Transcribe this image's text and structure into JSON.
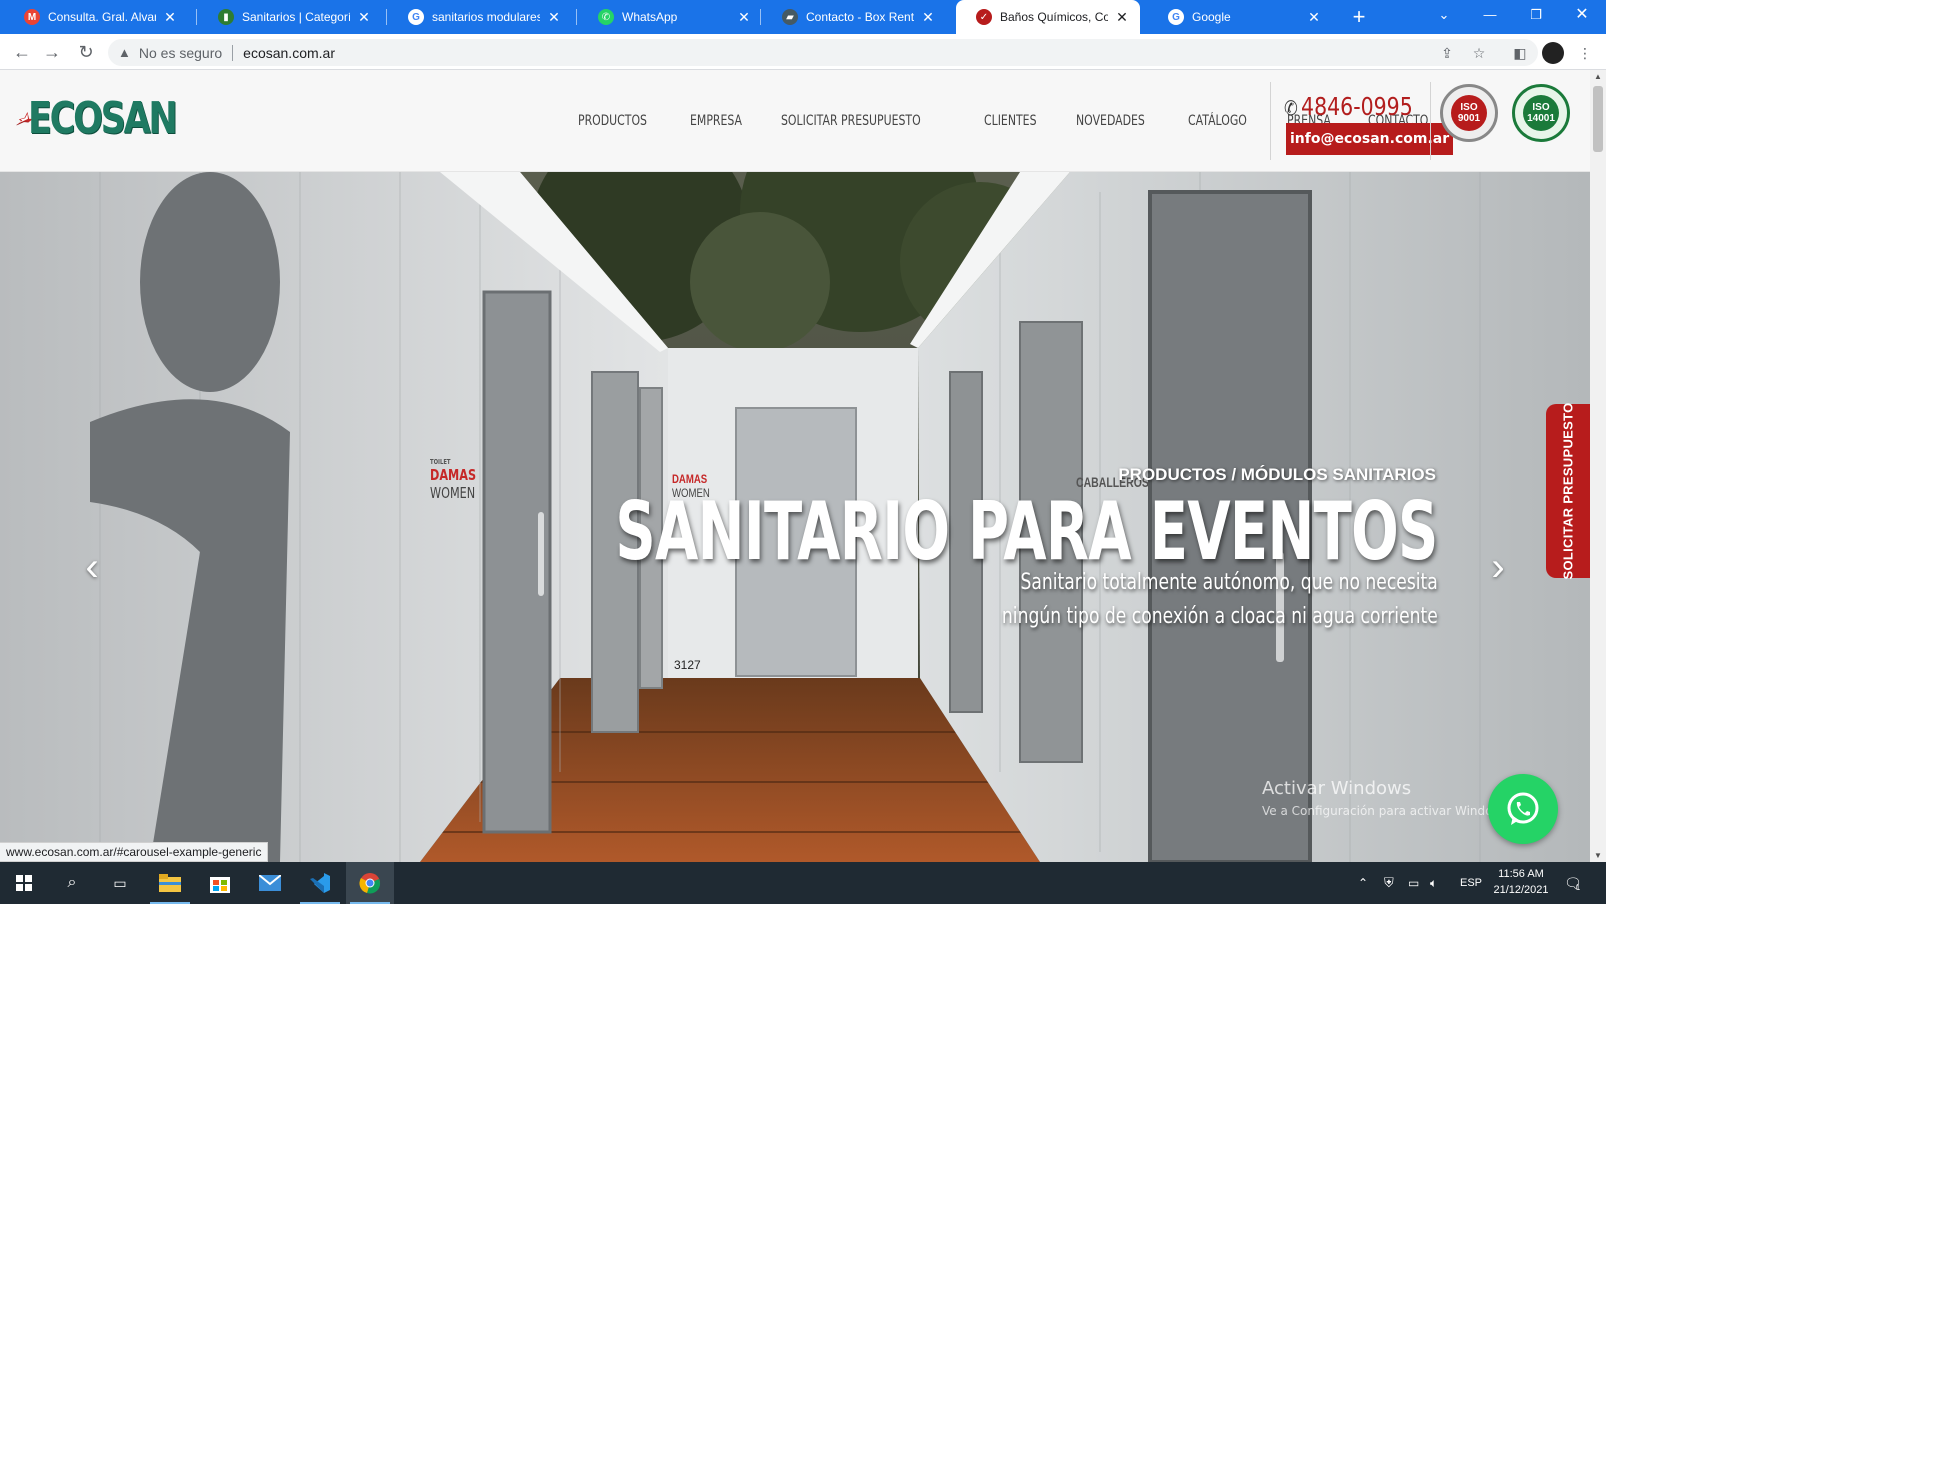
{
  "browser": {
    "tabs": [
      {
        "title": "Consulta. Gral. Alvarado",
        "favicon": "gmail-icon",
        "fav_color": "#ea4335",
        "fav_glyph": "M"
      },
      {
        "title": "Sanitarios | Categorías d",
        "favicon": "site-icon",
        "fav_color": "#2e7d32",
        "fav_glyph": "▮"
      },
      {
        "title": "sanitarios modulares - G",
        "favicon": "google-icon",
        "fav_color": "#ffffff",
        "fav_glyph": "G"
      },
      {
        "title": "WhatsApp",
        "favicon": "whatsapp-icon",
        "fav_color": "#25d366",
        "fav_glyph": "✆"
      },
      {
        "title": "Contacto - Box Rental S",
        "favicon": "boxrental-icon",
        "fav_color": "#455a64",
        "fav_glyph": "▰"
      },
      {
        "title": "Baños Químicos, Constr",
        "favicon": "ecosan-icon",
        "fav_color": "#b71c1c",
        "fav_glyph": "✓"
      },
      {
        "title": "Google",
        "favicon": "google-icon",
        "fav_color": "#ffffff",
        "fav_glyph": "G"
      }
    ],
    "active_tab": 5,
    "security_label": "No es seguro",
    "url": "ecosan.com.ar",
    "status_url": "www.ecosan.com.ar/#carousel-example-generic"
  },
  "site": {
    "logo_text": "ECOSAN",
    "nav": [
      "PRODUCTOS",
      "EMPRESA",
      "SOLICITAR PRESUPUESTO",
      "CLIENTES",
      "NOVEDADES",
      "CATÁLOGO",
      "PRENSA",
      "CONTACTO"
    ],
    "phone": "4846-0995",
    "email": "info@ecosan.com.ar",
    "badges": [
      {
        "label": "ISO",
        "number": "9001",
        "color": "#b71c1c"
      },
      {
        "label": "ISO",
        "number": "14001",
        "color": "#1b7a3a"
      }
    ]
  },
  "hero": {
    "subtitle": "PRODUCTOS / MÓDULOS SANITARIOS",
    "title": "SANITARIO PARA EVENTOS",
    "desc_line1": "Sanitario totalmente autónomo, que no necesita",
    "desc_line2": "ningún tipo de conexión a cloaca ni agua corriente",
    "quote_tab": "SOLICITAR PRESUPUESTO",
    "prev_icon": "chevron-left-icon",
    "next_icon": "chevron-right-icon",
    "sign_left_small": "TOILET",
    "sign_left_big": "DAMAS",
    "sign_left_sub": "WOMEN",
    "sign_center_big": "DAMAS",
    "sign_center_sub": "WOMEN",
    "sign_right_big": "CABALLEROS",
    "door_number": "3127"
  },
  "watermark": {
    "line1": "Activar Windows",
    "line2": "Ve a Configuración para activar Windows."
  },
  "taskbar": {
    "language": "ESP",
    "time": "11:56 AM",
    "date": "21/12/2021",
    "notification_count": "1"
  }
}
